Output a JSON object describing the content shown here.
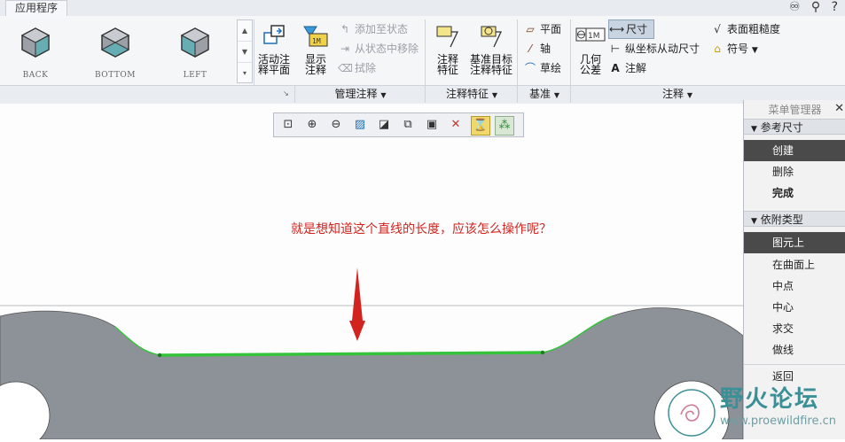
{
  "window": {
    "tab": "应用程序",
    "top_icons": "♾ ⚲ ?"
  },
  "ribbon": {
    "views": [
      {
        "label": "BACK",
        "icon": "cube-back-icon"
      },
      {
        "label": "BOTTOM",
        "icon": "cube-bottom-icon"
      },
      {
        "label": "LEFT",
        "icon": "cube-left-icon"
      }
    ],
    "activate_plane": "活动注\n释平面",
    "show_annotation": "显示\n注释",
    "add_to_state": "添加至状态",
    "remove_from_state": "从状态中移除",
    "erase": "拭除",
    "annotation_feature": "注释\n特征",
    "datum_target": "基准目标\n注释特征",
    "plane": "平面",
    "axis": "轴",
    "sketch": "草绘",
    "gtol": "几何\n公差",
    "dimension": "尺寸",
    "ordinate_dim": "纵坐标从动尺寸",
    "note": "注解",
    "surface_finish": "表面粗糙度",
    "symbol": "符号",
    "groups": {
      "manage": "管理注释",
      "feature": "注释特征",
      "datum": "基准",
      "annotation": "注释"
    }
  },
  "canvas": {
    "question": "就是想知道这个直线的长度，应该怎么操作呢？"
  },
  "menu": {
    "title": "菜单管理器",
    "section1": "参考尺寸",
    "section1_items": [
      "创建",
      "删除",
      "完成"
    ],
    "section2": "依附类型",
    "section2_items": [
      "图元上",
      "在曲面上",
      "中点",
      "中心",
      "求交",
      "做线"
    ],
    "back": "返回"
  },
  "watermark": {
    "title": "野火论坛",
    "url": "www.proewildfire.cn"
  },
  "colors": {
    "question": "#d2231e",
    "edge_highlight": "#35c33b",
    "part_fill": "#8d9298",
    "menu_selected": "#4a4a4a"
  }
}
